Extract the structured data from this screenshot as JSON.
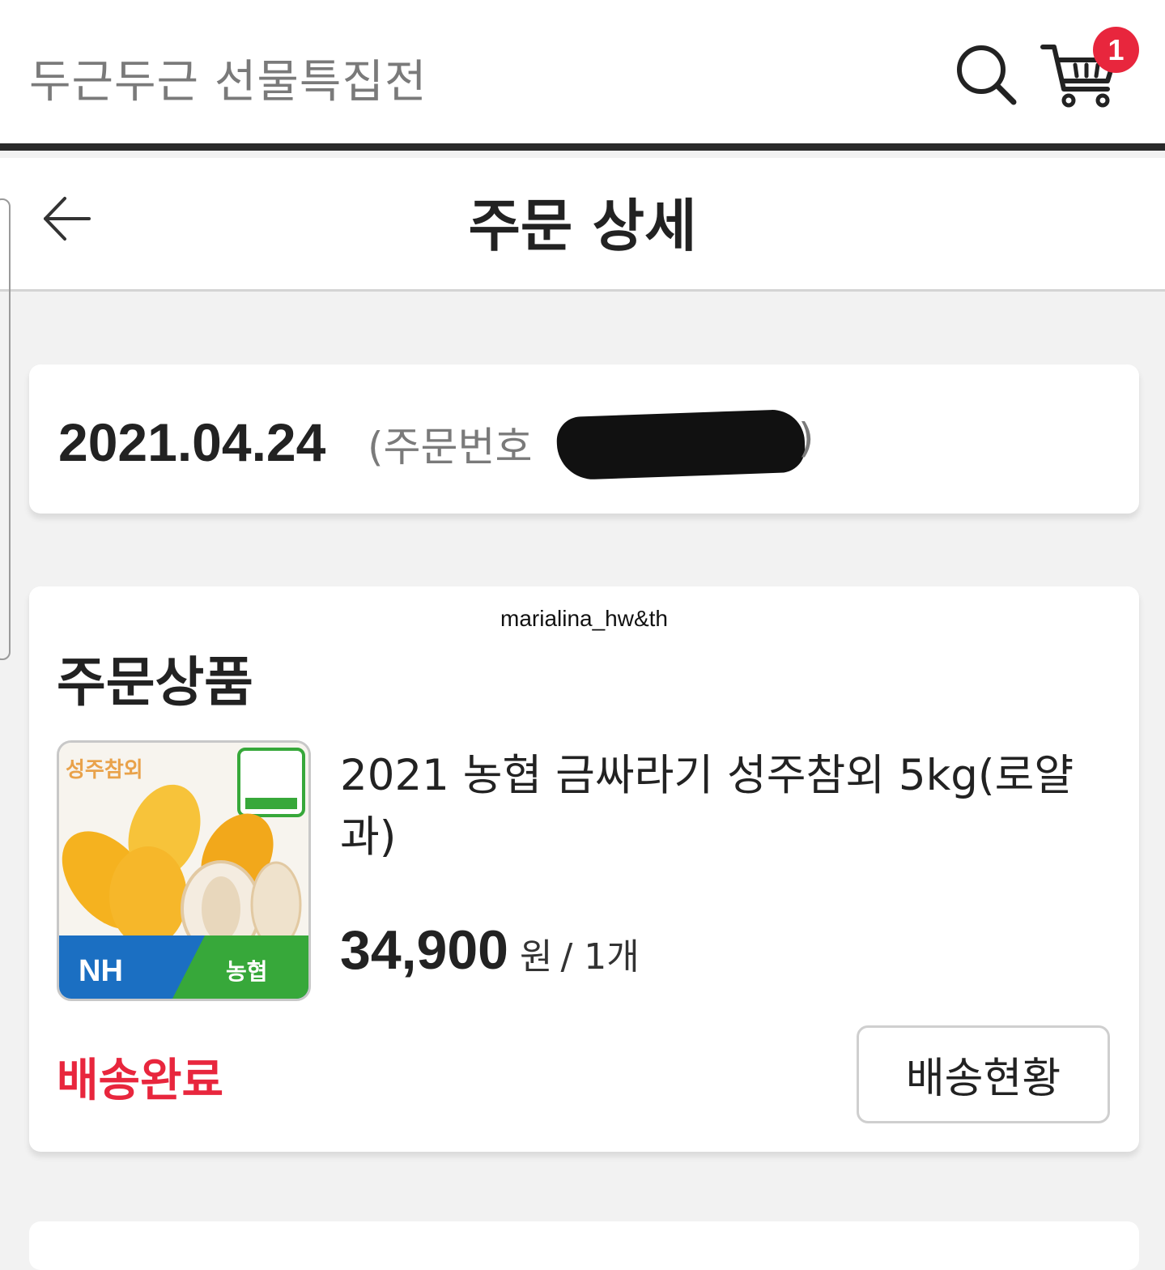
{
  "header": {
    "app_title": "두근두근 선물특집전",
    "cart_count": "1"
  },
  "subheader": {
    "title": "주문 상세"
  },
  "order": {
    "date": "2021.04.24",
    "number_label": "(주문번호 ",
    "number_close": ")"
  },
  "product_section": {
    "watermark": "marialina_hw&th",
    "title": "주문상품",
    "item": {
      "name": "2021 농협 금싸라기 성주참외 5kg(로얄과)",
      "price": "34,900",
      "currency": "원",
      "quantity": "/ 1개",
      "thumb_text_top": "성주참외",
      "thumb_logo_left": "NH",
      "thumb_logo_right": "농협"
    },
    "status": "배송완료",
    "track_button": "배송현황"
  },
  "colors": {
    "accent_red": "#e8263d",
    "dark_bar": "#2a2a2a",
    "nh_blue": "#1b6fc2",
    "nh_green": "#37a83a"
  },
  "icons": {
    "search": "search-icon",
    "cart": "cart-icon",
    "back": "arrow-left-icon"
  }
}
